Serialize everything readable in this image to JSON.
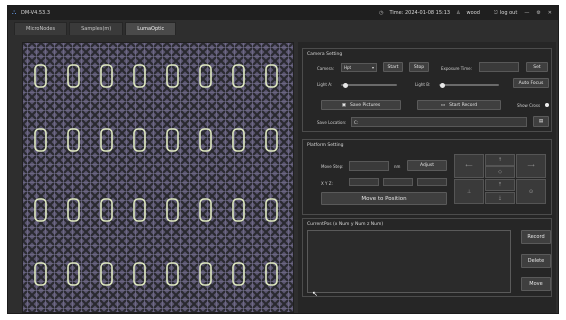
{
  "window": {
    "title": "DM-V4.53.3",
    "time": "Time: 2024-01-08 15:13",
    "user": "wood",
    "logout": "log out",
    "minimize": "—",
    "settings": "⚙",
    "close": "✕"
  },
  "tabs": [
    "MicroNodes",
    "Samples(m)",
    "LumaOptic"
  ],
  "camera": {
    "group_title": "Camera Setting",
    "camera_label": "Camera:",
    "camera_value": "Hpt",
    "start": "Start",
    "stop": "Stop",
    "exposure_label": "Exposure Time:",
    "exposure_value": "",
    "set": "Set",
    "light_a_label": "Light A:",
    "light_a_level": 0.08,
    "light_b_label": "Light B:",
    "light_b_level": 0.06,
    "auto_focus": "Auto Focus",
    "save_pictures": "Save Pictures",
    "start_record": "Start Record",
    "show_cross": "Show Cross",
    "save_location_label": "Save Location:",
    "save_location_value": "C:",
    "folder_icon": "folder-icon"
  },
  "platform": {
    "group_title": "Platform Setting",
    "move_step_label": "Move Step:",
    "move_step_value": "",
    "move_step_unit": "nm",
    "adjust": "Adjust",
    "xyz_label": "X Y Z:",
    "x_value": "",
    "y_value": "",
    "z_value": "",
    "move_to_position": "Move to Position",
    "pad_up": "↑",
    "pad_left": "←",
    "pad_right": "→",
    "pad_down": "↓",
    "pad_left_arrows": "⟵",
    "pad_right_arrows": "⟶",
    "pad_z_up": "⤒",
    "pad_z_down": "⤓",
    "pad_center": "◇",
    "pad_bottom_left": "⊥",
    "pad_bottom_right": "⊙"
  },
  "currentpos": {
    "group_title": "CurrentPos (x Num y Num z Num)",
    "record": "Record",
    "delete": "Delete",
    "move": "Move"
  }
}
